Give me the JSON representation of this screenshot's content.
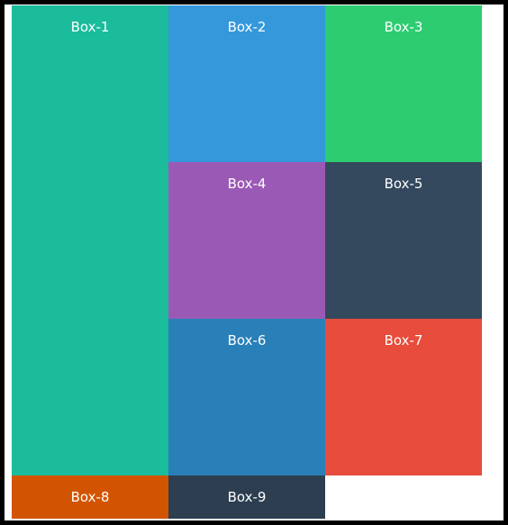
{
  "boxes": [
    {
      "label": "Box-1",
      "color": "#1abc9c"
    },
    {
      "label": "Box-2",
      "color": "#3498db"
    },
    {
      "label": "Box-3",
      "color": "#2ecc71"
    },
    {
      "label": "Box-4",
      "color": "#9b59b6"
    },
    {
      "label": "Box-5",
      "color": "#34495e"
    },
    {
      "label": "Box-6",
      "color": "#2980b9"
    },
    {
      "label": "Box-7",
      "color": "#e74c3c"
    },
    {
      "label": "Box-8",
      "color": "#d35400"
    },
    {
      "label": "Box-9",
      "color": "#2c3e50"
    }
  ],
  "colors": {
    "frame_border": "#000000",
    "background": "#ffffff"
  }
}
